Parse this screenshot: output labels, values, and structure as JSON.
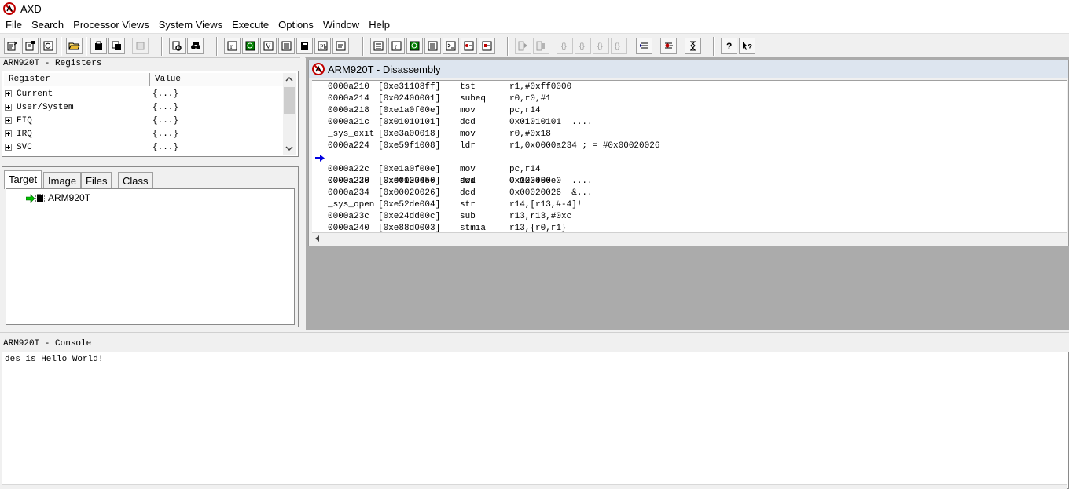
{
  "app": {
    "title": "AXD"
  },
  "menu": [
    "File",
    "Search",
    "Processor Views",
    "System Views",
    "Execute",
    "Options",
    "Window",
    "Help"
  ],
  "registers": {
    "title": "ARM920T - Registers",
    "columns": [
      "Register",
      "Value"
    ],
    "rows": [
      {
        "name": "Current",
        "value": "{...}"
      },
      {
        "name": "User/System",
        "value": "{...}"
      },
      {
        "name": "FIQ",
        "value": "{...}"
      },
      {
        "name": "IRQ",
        "value": "{...}"
      },
      {
        "name": "SVC",
        "value": "{...}"
      }
    ]
  },
  "workspace": {
    "tabs": [
      "Target",
      "Image",
      "Files",
      "Class"
    ],
    "active_tab": "Target",
    "tree": {
      "label": "ARM920T"
    }
  },
  "disassembly": {
    "title": "ARM920T - Disassembly",
    "current_row": 6,
    "rows": [
      {
        "addr": "0000a210",
        "op": "[0xe31108ff]",
        "mn": "tst",
        "args": "r1,#0xff0000"
      },
      {
        "addr": "0000a214",
        "op": "[0x02400001]",
        "mn": "subeq",
        "args": "r0,r0,#1"
      },
      {
        "addr": "0000a218",
        "op": "[0xe1a0f00e]",
        "mn": "mov",
        "args": "pc,r14"
      },
      {
        "addr": "0000a21c",
        "op": "[0x01010101]",
        "mn": "dcd",
        "args": "0x01010101  ...."
      },
      {
        "addr": "_sys_exit",
        "op": "[0xe3a00018]",
        "mn": "mov",
        "args": "r0,#0x18"
      },
      {
        "addr": "0000a224",
        "op": "[0xe59f1008]",
        "mn": "ldr",
        "args": "r1,0x0000a234 ; = #0x00020026"
      },
      {
        "addr": "0000a228",
        "op": "[0xef123456]",
        "mn": "swi",
        "args": "0x123456"
      },
      {
        "addr": "0000a22c",
        "op": "[0xe1a0f00e]",
        "mn": "mov",
        "args": "pc,r14"
      },
      {
        "addr": "0000a230",
        "op": "[0x000000e0]",
        "mn": "dcd",
        "args": "0x000000e0  ...."
      },
      {
        "addr": "0000a234",
        "op": "[0x00020026]",
        "mn": "dcd",
        "args": "0x00020026  &..."
      },
      {
        "addr": "_sys_open",
        "op": "[0xe52de004]",
        "mn": "str",
        "args": "r14,[r13,#-4]!"
      },
      {
        "addr": "0000a23c",
        "op": "[0xe24dd00c]",
        "mn": "sub",
        "args": "r13,r13,#0xc"
      },
      {
        "addr": "0000a240",
        "op": "[0xe88d0003]",
        "mn": "stmia",
        "args": "r13,{r0,r1}"
      }
    ]
  },
  "console": {
    "title": "ARM920T - Console",
    "output": "des is Hello World!"
  },
  "toolbar_icons": [
    "reload-image-icon",
    "load-image-icon",
    "reload-session-icon",
    "open-file-icon",
    "load-memory-icon",
    "save-memory-icon",
    "clear-icon",
    "find-icon",
    "find-next-icon",
    "registers-view-icon",
    "watch-view-icon",
    "variables-view-icon",
    "memory-view-icon",
    "disassembly-view-icon",
    "source-view-icon",
    "backtrace-view-icon",
    "registers-sys-view-icon",
    "watch-sys-view-icon",
    "variables-sys-view-icon",
    "memory-sys-view-icon",
    "console-view-icon",
    "breakpoints-view-icon",
    "watchpoints-view-icon",
    "go-icon",
    "stop-icon",
    "step-in-icon",
    "step-icon",
    "step-out-icon",
    "run-to-cursor-icon",
    "toggle-breakpoint-icon",
    "watch-icon",
    "delay-icon",
    "help-icon",
    "context-help-icon"
  ]
}
